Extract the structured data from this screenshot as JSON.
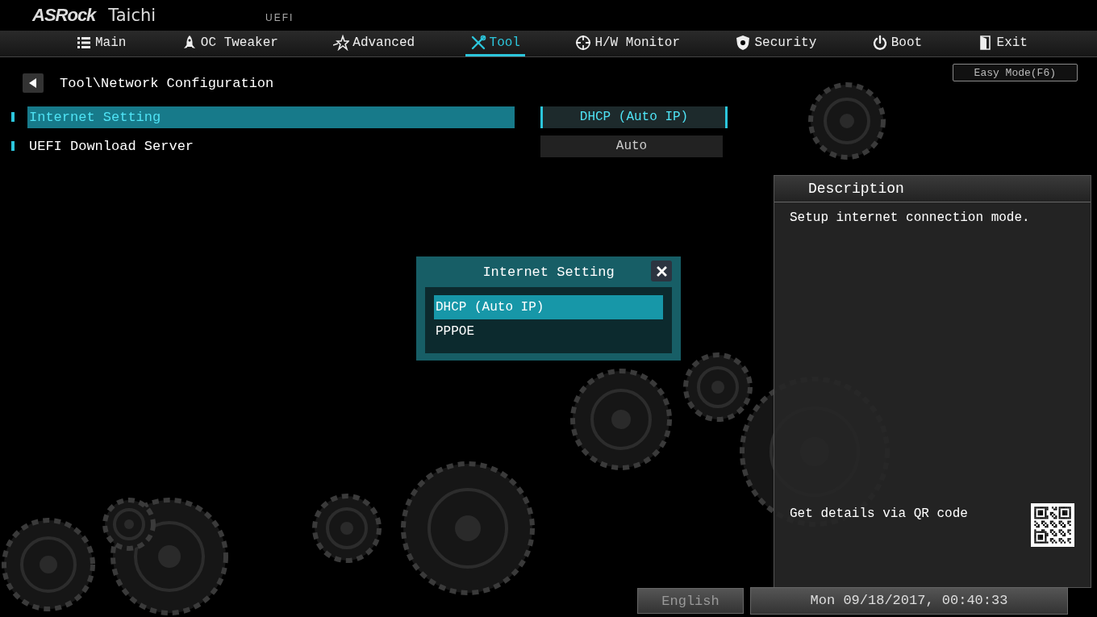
{
  "header": {
    "brand": "ASRock",
    "model": "Taichi",
    "firmware": "UEFI"
  },
  "tabs": [
    {
      "label": "Main",
      "kind": "list",
      "selected": false
    },
    {
      "label": "OC Tweaker",
      "kind": "rocket",
      "selected": false
    },
    {
      "label": "Advanced",
      "kind": "star",
      "selected": false
    },
    {
      "label": "Tool",
      "kind": "tools",
      "selected": true
    },
    {
      "label": "H/W Monitor",
      "kind": "crosshair",
      "selected": false
    },
    {
      "label": "Security",
      "kind": "shield",
      "selected": false
    },
    {
      "label": "Boot",
      "kind": "power",
      "selected": false
    },
    {
      "label": "Exit",
      "kind": "door",
      "selected": false
    }
  ],
  "easy_mode_button": "Easy Mode(F6)",
  "breadcrumb": "Tool\\Network Configuration",
  "settings": [
    {
      "label": "Internet Setting",
      "value": "DHCP (Auto IP)",
      "selected": true
    },
    {
      "label": "UEFI Download Server",
      "value": "Auto",
      "selected": false
    }
  ],
  "dialog": {
    "title": "Internet Setting",
    "options": [
      {
        "label": "DHCP (Auto IP)",
        "selected": true
      },
      {
        "label": "PPPOE",
        "selected": false
      }
    ]
  },
  "description": {
    "title": "Description",
    "text": "Setup internet connection mode.",
    "qr_hint": "Get details via QR code"
  },
  "status_bar": {
    "language": "English",
    "datetime": "Mon 09/18/2017, 00:40:33"
  }
}
